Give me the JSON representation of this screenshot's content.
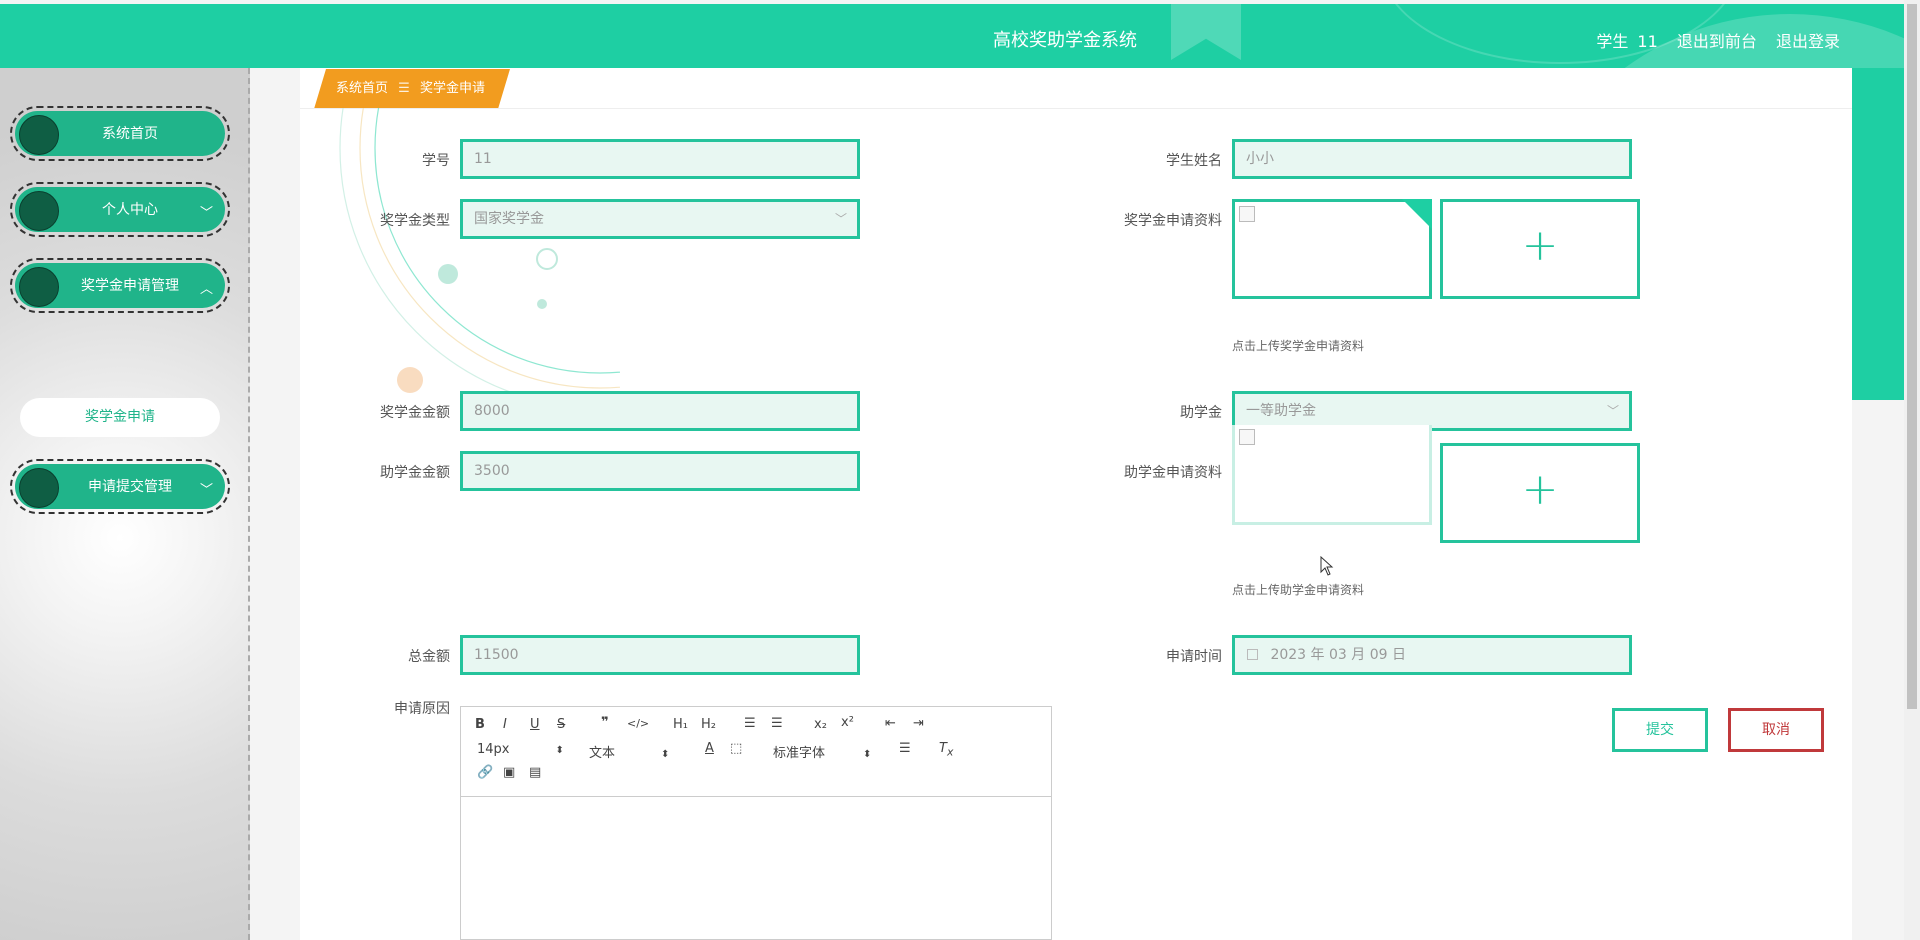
{
  "header": {
    "title": "高校奖助学金系统",
    "user_label": "学生 11",
    "front_link": "退出到前台",
    "logout_link": "退出登录"
  },
  "sidebar": {
    "items": [
      {
        "label": "系统首页",
        "chevron": ""
      },
      {
        "label": "个人中心",
        "chevron": "﹀"
      },
      {
        "label": "奖学金申请管理",
        "chevron": "︿"
      },
      {
        "label": "申请提交管理",
        "chevron": "﹀"
      }
    ],
    "sub_item": "奖学金申请"
  },
  "breadcrumb": {
    "home": "系统首页",
    "separator": "☰",
    "current": "奖学金申请"
  },
  "form": {
    "student_id": {
      "label": "学号",
      "value": "11"
    },
    "student_name": {
      "label": "学生姓名",
      "value": "小小"
    },
    "scholarship_type": {
      "label": "奖学金类型",
      "value": "国家奖学金"
    },
    "scholarship_material": {
      "label": "奖学金申请资料",
      "hint": "点击上传奖学金申请资料"
    },
    "scholarship_amount": {
      "label": "奖学金金额",
      "value": "8000"
    },
    "grant": {
      "label": "助学金",
      "value": "一等助学金"
    },
    "grant_amount": {
      "label": "助学金金额",
      "value": "3500"
    },
    "grant_material": {
      "label": "助学金申请资料",
      "hint": "点击上传助学金申请资料"
    },
    "total_amount": {
      "label": "总金额",
      "value": "11500"
    },
    "apply_time": {
      "label": "申请时间",
      "value": "2023 年 03 月 09 日"
    },
    "reason": {
      "label": "申请原因"
    }
  },
  "editor": {
    "font_size": "14px",
    "text_style": "文本",
    "font_family": "标准字体"
  },
  "buttons": {
    "submit": "提交",
    "cancel": "取消"
  },
  "icons": {
    "plus": "+"
  },
  "colors": {
    "primary": "#1ecfa3",
    "accent": "#25c39c",
    "menu": "#20b48a",
    "breadcrumb": "#f29c1f",
    "danger": "#c0393b"
  }
}
